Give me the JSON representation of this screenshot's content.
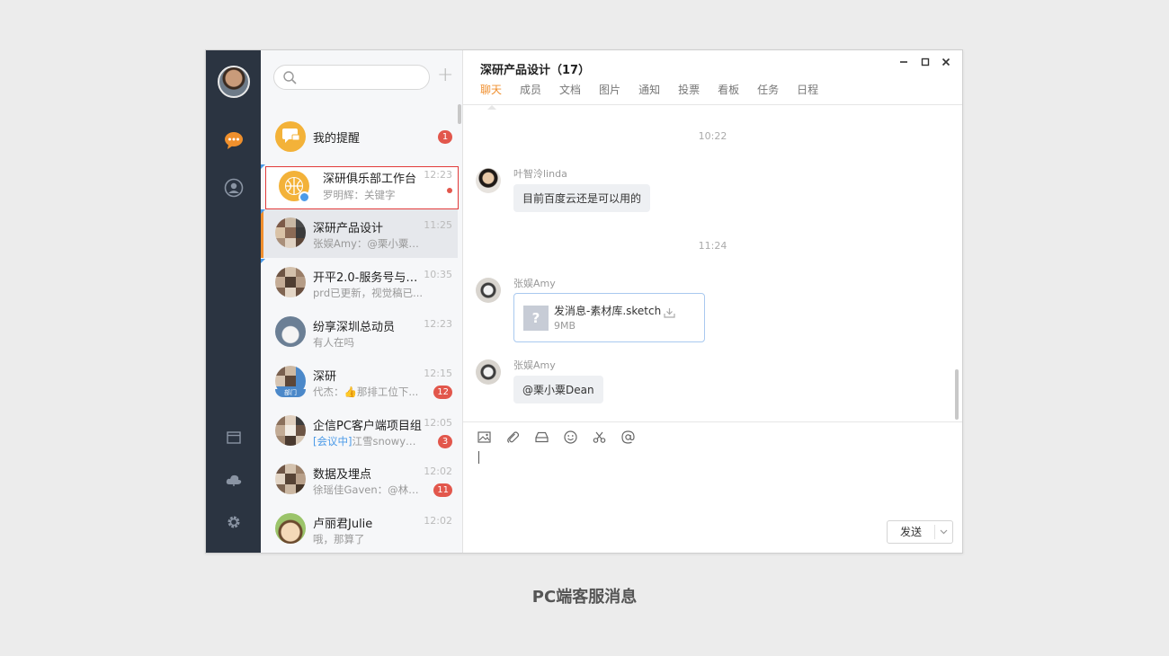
{
  "search": {
    "placeholder": ""
  },
  "conversations": [
    {
      "name": "我的提醒",
      "msg": "",
      "time": "",
      "badge": "1"
    },
    {
      "name": "深研俱乐部工作台",
      "msg": "罗明辉：关键字",
      "time": "12:23",
      "badge": ""
    },
    {
      "name": "深研产品设计",
      "msg": "张娱Amy：@栗小粟D...",
      "time": "11:25",
      "badge": ""
    },
    {
      "name": "开平2.0-服务号与消息...",
      "msg": "prd已更新，视觉稿已...",
      "time": "10:35",
      "badge": ""
    },
    {
      "name": "纷享深圳总动员",
      "msg": "有人在吗",
      "time": "12:23",
      "badge": ""
    },
    {
      "name": "深研",
      "msg": "代杰：👍那排工位下...",
      "time": "12:15",
      "badge": "12",
      "tag": "部门"
    },
    {
      "name": "企信PC客户端项目组",
      "msg_prefix": "[会议中]",
      "msg": "江雪snowy：[...",
      "time": "12:05",
      "badge": "3"
    },
    {
      "name": "数据及埋点",
      "msg": "徐瑶佳Gaven：@林鸣...",
      "time": "12:02",
      "badge": "11"
    },
    {
      "name": "卢丽君Julie",
      "msg": "哦，那算了",
      "time": "12:02",
      "badge": ""
    }
  ],
  "chat": {
    "title": "深研产品设计（17）",
    "tabs": [
      "聊天",
      "成员",
      "文档",
      "图片",
      "通知",
      "投票",
      "看板",
      "任务",
      "日程"
    ],
    "messages": {
      "ts1": "10:22",
      "m1_name": "叶智泠linda",
      "m1_text": "目前百度云还是可以用的",
      "ts2": "11:24",
      "m2_name": "张娱Amy",
      "file_name": "发消息-素材库.sketch",
      "file_size": "9MB",
      "m3_name": "张娱Amy",
      "m3_text": "@栗小粟Dean"
    },
    "send_label": "发送"
  },
  "caption": "PC端客服消息",
  "colors": {
    "accent": "#f08f2e",
    "rail": "#2b3441",
    "badge": "#e2574c",
    "highlight": "#e23a3a"
  }
}
